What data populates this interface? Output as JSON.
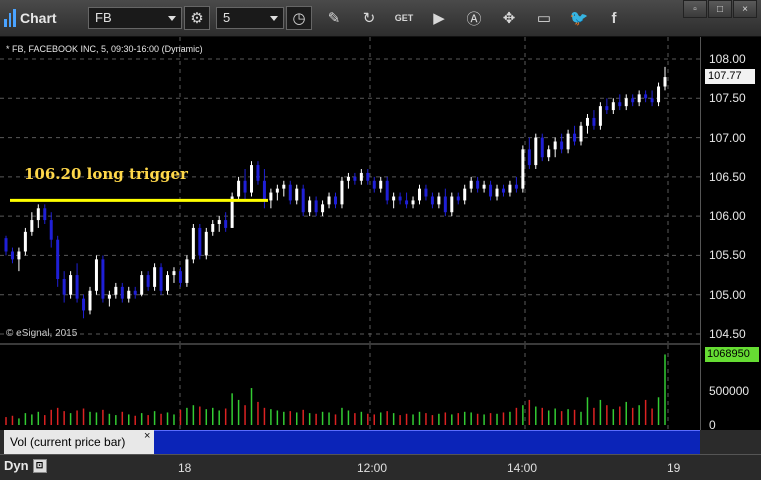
{
  "toolbar": {
    "title": "Chart",
    "symbol": "FB",
    "interval": "5",
    "window_buttons": [
      "▫",
      "□",
      "×"
    ],
    "icons": [
      "gear-icon",
      "clock-icon",
      "pencil-icon",
      "refresh-icon",
      "get-icon",
      "play-icon",
      "a-icon",
      "drag-icon",
      "comment-icon",
      "twitter-icon",
      "facebook-icon"
    ]
  },
  "chart": {
    "symbol_line": "* FB, FACEBOOK INC, 5, 09:30-16:00 (Dynamic)",
    "copyright": "© eSignal, 2015",
    "annotation": "106.20 long trigger",
    "last_price": "107.77",
    "last_volume": "1068950",
    "price_axis_labels": [
      "108.00",
      "107.50",
      "107.00",
      "106.50",
      "106.00",
      "105.50",
      "105.00",
      "104.50"
    ],
    "volume_axis_labels": [
      "500000",
      "0"
    ],
    "time_axis_labels": [
      "18",
      "12:00",
      "14:00",
      "19"
    ],
    "volume_panel_label": "Vol (current price bar)",
    "dyn_label": "Dyn",
    "colors": {
      "up": "#ffffff",
      "down": "#1f1fd6",
      "trigger": "#ffff00",
      "vol_up": "#33cc33",
      "vol_down": "#dd2222",
      "grid": "#5a5a5a"
    }
  },
  "chart_data": {
    "type": "candlestick",
    "trigger_level": 106.2,
    "ylim": [
      104.4,
      108.1
    ],
    "candles": [
      [
        105.72,
        105.75,
        105.5,
        105.55
      ],
      [
        105.55,
        105.6,
        105.4,
        105.45
      ],
      [
        105.45,
        105.6,
        105.3,
        105.55
      ],
      [
        105.55,
        105.85,
        105.5,
        105.8
      ],
      [
        105.8,
        106.05,
        105.75,
        105.95
      ],
      [
        105.95,
        106.15,
        105.85,
        106.1
      ],
      [
        106.1,
        106.15,
        105.9,
        105.95
      ],
      [
        105.95,
        106.05,
        105.6,
        105.7
      ],
      [
        105.7,
        105.75,
        105.1,
        105.2
      ],
      [
        105.2,
        105.3,
        104.9,
        105.0
      ],
      [
        105.0,
        105.3,
        104.95,
        105.25
      ],
      [
        105.25,
        105.4,
        104.9,
        104.95
      ],
      [
        104.95,
        105.0,
        104.7,
        104.8
      ],
      [
        104.8,
        105.1,
        104.75,
        105.05
      ],
      [
        105.05,
        105.5,
        105.0,
        105.45
      ],
      [
        105.45,
        105.5,
        104.9,
        104.95
      ],
      [
        104.95,
        105.05,
        104.85,
        105.0
      ],
      [
        105.0,
        105.15,
        104.95,
        105.1
      ],
      [
        105.1,
        105.15,
        104.9,
        104.95
      ],
      [
        104.95,
        105.1,
        104.9,
        105.05
      ],
      [
        105.05,
        105.1,
        104.95,
        105.0
      ],
      [
        105.0,
        105.3,
        104.98,
        105.25
      ],
      [
        105.25,
        105.3,
        105.05,
        105.1
      ],
      [
        105.1,
        105.4,
        105.05,
        105.35
      ],
      [
        105.35,
        105.4,
        105.0,
        105.05
      ],
      [
        105.05,
        105.3,
        105.0,
        105.25
      ],
      [
        105.25,
        105.35,
        105.15,
        105.3
      ],
      [
        105.3,
        105.35,
        105.1,
        105.15
      ],
      [
        105.15,
        105.5,
        105.1,
        105.45
      ],
      [
        105.45,
        105.9,
        105.4,
        105.85
      ],
      [
        105.85,
        105.9,
        105.45,
        105.5
      ],
      [
        105.5,
        105.85,
        105.45,
        105.8
      ],
      [
        105.8,
        105.95,
        105.75,
        105.9
      ],
      [
        105.9,
        106.0,
        105.8,
        105.95
      ],
      [
        105.95,
        106.05,
        105.8,
        105.85
      ],
      [
        105.85,
        106.3,
        105.85,
        106.25
      ],
      [
        106.25,
        106.5,
        106.2,
        106.45
      ],
      [
        106.45,
        106.6,
        106.2,
        106.3
      ],
      [
        106.3,
        106.7,
        106.25,
        106.65
      ],
      [
        106.65,
        106.7,
        106.4,
        106.45
      ],
      [
        106.45,
        106.6,
        106.1,
        106.2
      ],
      [
        106.2,
        106.35,
        106.1,
        106.3
      ],
      [
        106.3,
        106.4,
        106.2,
        106.35
      ],
      [
        106.35,
        106.45,
        106.25,
        106.4
      ],
      [
        106.4,
        106.45,
        106.15,
        106.2
      ],
      [
        106.2,
        106.4,
        106.15,
        106.35
      ],
      [
        106.35,
        106.4,
        106.0,
        106.05
      ],
      [
        106.05,
        106.25,
        106.0,
        106.2
      ],
      [
        106.2,
        106.25,
        106.0,
        106.05
      ],
      [
        106.05,
        106.2,
        106.0,
        106.15
      ],
      [
        106.15,
        106.3,
        106.1,
        106.25
      ],
      [
        106.25,
        106.3,
        106.1,
        106.15
      ],
      [
        106.15,
        106.5,
        106.1,
        106.45
      ],
      [
        106.45,
        106.55,
        106.35,
        106.5
      ],
      [
        106.5,
        106.55,
        106.4,
        106.45
      ],
      [
        106.45,
        106.6,
        106.4,
        106.55
      ],
      [
        106.55,
        106.6,
        106.4,
        106.45
      ],
      [
        106.45,
        106.5,
        106.3,
        106.35
      ],
      [
        106.35,
        106.5,
        106.3,
        106.45
      ],
      [
        106.45,
        106.5,
        106.15,
        106.2
      ],
      [
        106.2,
        106.3,
        106.1,
        106.25
      ],
      [
        106.25,
        106.3,
        106.15,
        106.2
      ],
      [
        106.2,
        106.3,
        106.1,
        106.15
      ],
      [
        106.15,
        106.25,
        106.1,
        106.2
      ],
      [
        106.2,
        106.4,
        106.15,
        106.35
      ],
      [
        106.35,
        106.4,
        106.2,
        106.25
      ],
      [
        106.25,
        106.3,
        106.1,
        106.15
      ],
      [
        106.15,
        106.3,
        106.1,
        106.25
      ],
      [
        106.25,
        106.35,
        106.0,
        106.05
      ],
      [
        106.05,
        106.3,
        106.0,
        106.25
      ],
      [
        106.25,
        106.3,
        106.15,
        106.2
      ],
      [
        106.2,
        106.4,
        106.15,
        106.35
      ],
      [
        106.35,
        106.5,
        106.3,
        106.45
      ],
      [
        106.45,
        106.5,
        106.3,
        106.35
      ],
      [
        106.35,
        106.45,
        106.3,
        106.4
      ],
      [
        106.4,
        106.45,
        106.2,
        106.25
      ],
      [
        106.25,
        106.4,
        106.2,
        106.35
      ],
      [
        106.35,
        106.4,
        106.25,
        106.3
      ],
      [
        106.3,
        106.45,
        106.25,
        106.4
      ],
      [
        106.4,
        106.5,
        106.3,
        106.35
      ],
      [
        106.35,
        106.9,
        106.3,
        106.85
      ],
      [
        106.85,
        107.0,
        106.6,
        106.65
      ],
      [
        106.65,
        107.05,
        106.6,
        107.0
      ],
      [
        107.0,
        107.05,
        106.7,
        106.75
      ],
      [
        106.75,
        106.9,
        106.7,
        106.85
      ],
      [
        106.85,
        107.0,
        106.75,
        106.95
      ],
      [
        106.95,
        107.05,
        106.8,
        106.85
      ],
      [
        106.85,
        107.1,
        106.8,
        107.05
      ],
      [
        107.05,
        107.15,
        106.9,
        106.95
      ],
      [
        106.95,
        107.2,
        106.9,
        107.15
      ],
      [
        107.15,
        107.3,
        107.05,
        107.25
      ],
      [
        107.25,
        107.35,
        107.1,
        107.15
      ],
      [
        107.15,
        107.45,
        107.1,
        107.4
      ],
      [
        107.4,
        107.5,
        107.3,
        107.35
      ],
      [
        107.35,
        107.5,
        107.3,
        107.45
      ],
      [
        107.45,
        107.55,
        107.35,
        107.4
      ],
      [
        107.4,
        107.55,
        107.35,
        107.5
      ],
      [
        107.5,
        107.55,
        107.4,
        107.45
      ],
      [
        107.45,
        107.6,
        107.4,
        107.55
      ],
      [
        107.55,
        107.6,
        107.45,
        107.5
      ],
      [
        107.5,
        107.6,
        107.4,
        107.45
      ],
      [
        107.45,
        107.7,
        107.4,
        107.65
      ],
      [
        107.65,
        107.9,
        107.6,
        107.77
      ]
    ],
    "volumes": [
      120000,
      140000,
      100000,
      180000,
      160000,
      200000,
      150000,
      230000,
      260000,
      210000,
      180000,
      220000,
      250000,
      200000,
      190000,
      230000,
      170000,
      150000,
      200000,
      160000,
      140000,
      180000,
      150000,
      210000,
      170000,
      190000,
      160000,
      230000,
      260000,
      300000,
      280000,
      240000,
      260000,
      220000,
      250000,
      480000,
      380000,
      300000,
      560000,
      350000,
      260000,
      240000,
      220000,
      200000,
      210000,
      190000,
      230000,
      180000,
      170000,
      200000,
      190000,
      160000,
      260000,
      220000,
      180000,
      200000,
      170000,
      160000,
      190000,
      210000,
      180000,
      150000,
      170000,
      160000,
      200000,
      180000,
      150000,
      170000,
      190000,
      160000,
      180000,
      200000,
      190000,
      170000,
      160000,
      180000,
      170000,
      190000,
      200000,
      260000,
      300000,
      380000,
      280000,
      260000,
      220000,
      250000,
      210000,
      240000,
      230000,
      200000,
      420000,
      260000,
      380000,
      300000,
      240000,
      280000,
      350000,
      260000,
      300000,
      380000,
      250000,
      420000,
      1068950
    ]
  }
}
